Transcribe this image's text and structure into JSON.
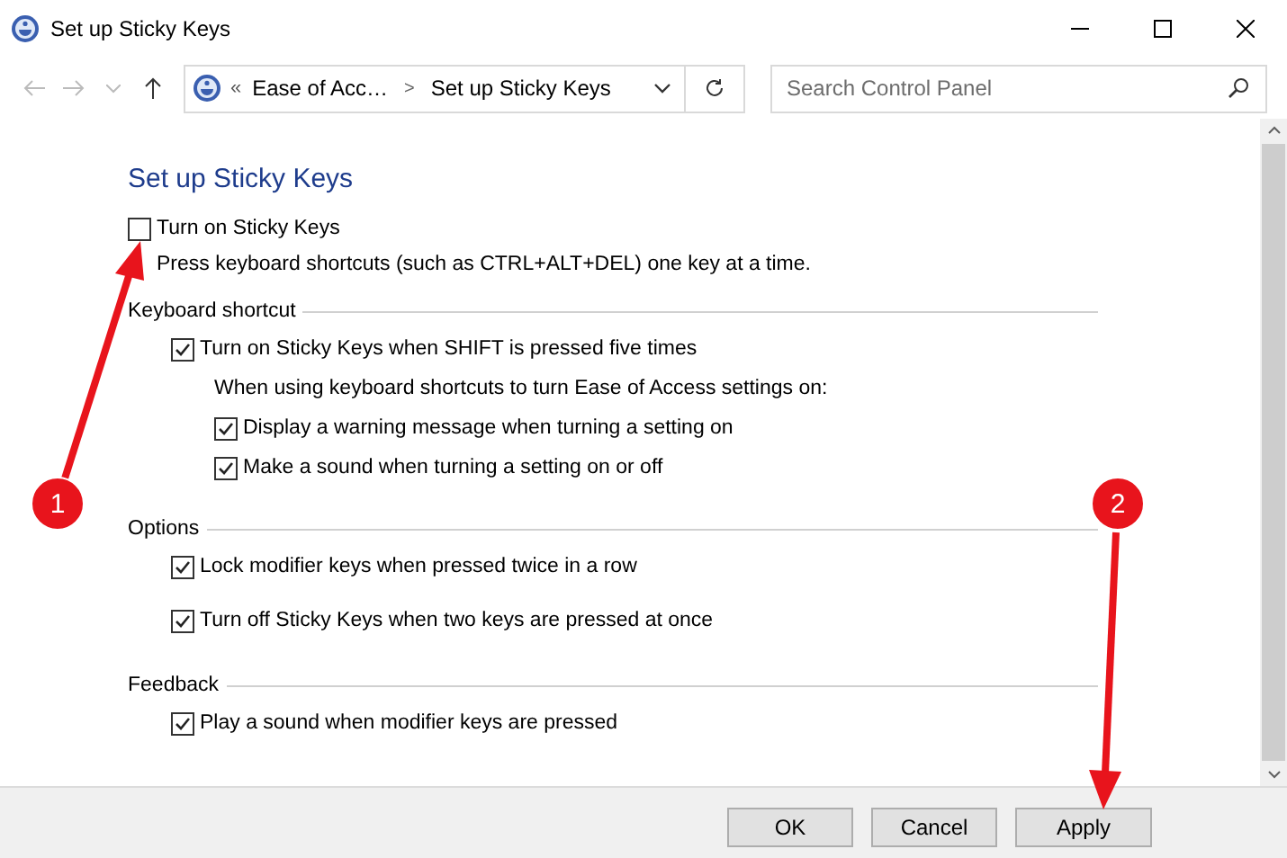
{
  "window": {
    "title": "Set up Sticky Keys"
  },
  "address": {
    "chevron": "«",
    "crumbs": [
      "Ease of Acc…",
      "Set up Sticky Keys"
    ],
    "separator": ">"
  },
  "search": {
    "placeholder": "Search Control Panel"
  },
  "heading": "Set up Sticky Keys",
  "main_option": {
    "label": "Turn on Sticky Keys",
    "checked": false,
    "description": "Press keyboard shortcuts (such as CTRL+ALT+DEL) one key at a time."
  },
  "sections": [
    {
      "title": "Keyboard shortcut",
      "items": [
        {
          "kind": "checkbox",
          "label": "Turn on Sticky Keys when SHIFT is pressed five times",
          "checked": true,
          "children": [
            {
              "kind": "note",
              "text": "When using keyboard shortcuts to turn Ease of Access settings on:"
            },
            {
              "kind": "checkbox",
              "label": "Display a warning message when turning a setting on",
              "checked": true
            },
            {
              "kind": "checkbox",
              "label": "Make a sound when turning a setting on or off",
              "checked": true
            }
          ]
        }
      ]
    },
    {
      "title": "Options",
      "items": [
        {
          "kind": "checkbox",
          "label": "Lock modifier keys when pressed twice in a row",
          "checked": true
        },
        {
          "kind": "checkbox",
          "label": "Turn off Sticky Keys when two keys are pressed at once",
          "checked": true
        }
      ]
    },
    {
      "title": "Feedback",
      "items": [
        {
          "kind": "checkbox",
          "label": "Play a sound when modifier keys are pressed",
          "checked": true
        }
      ]
    }
  ],
  "buttons": [
    "OK",
    "Cancel",
    "Apply"
  ],
  "callouts": [
    {
      "number": "1"
    },
    {
      "number": "2"
    }
  ]
}
